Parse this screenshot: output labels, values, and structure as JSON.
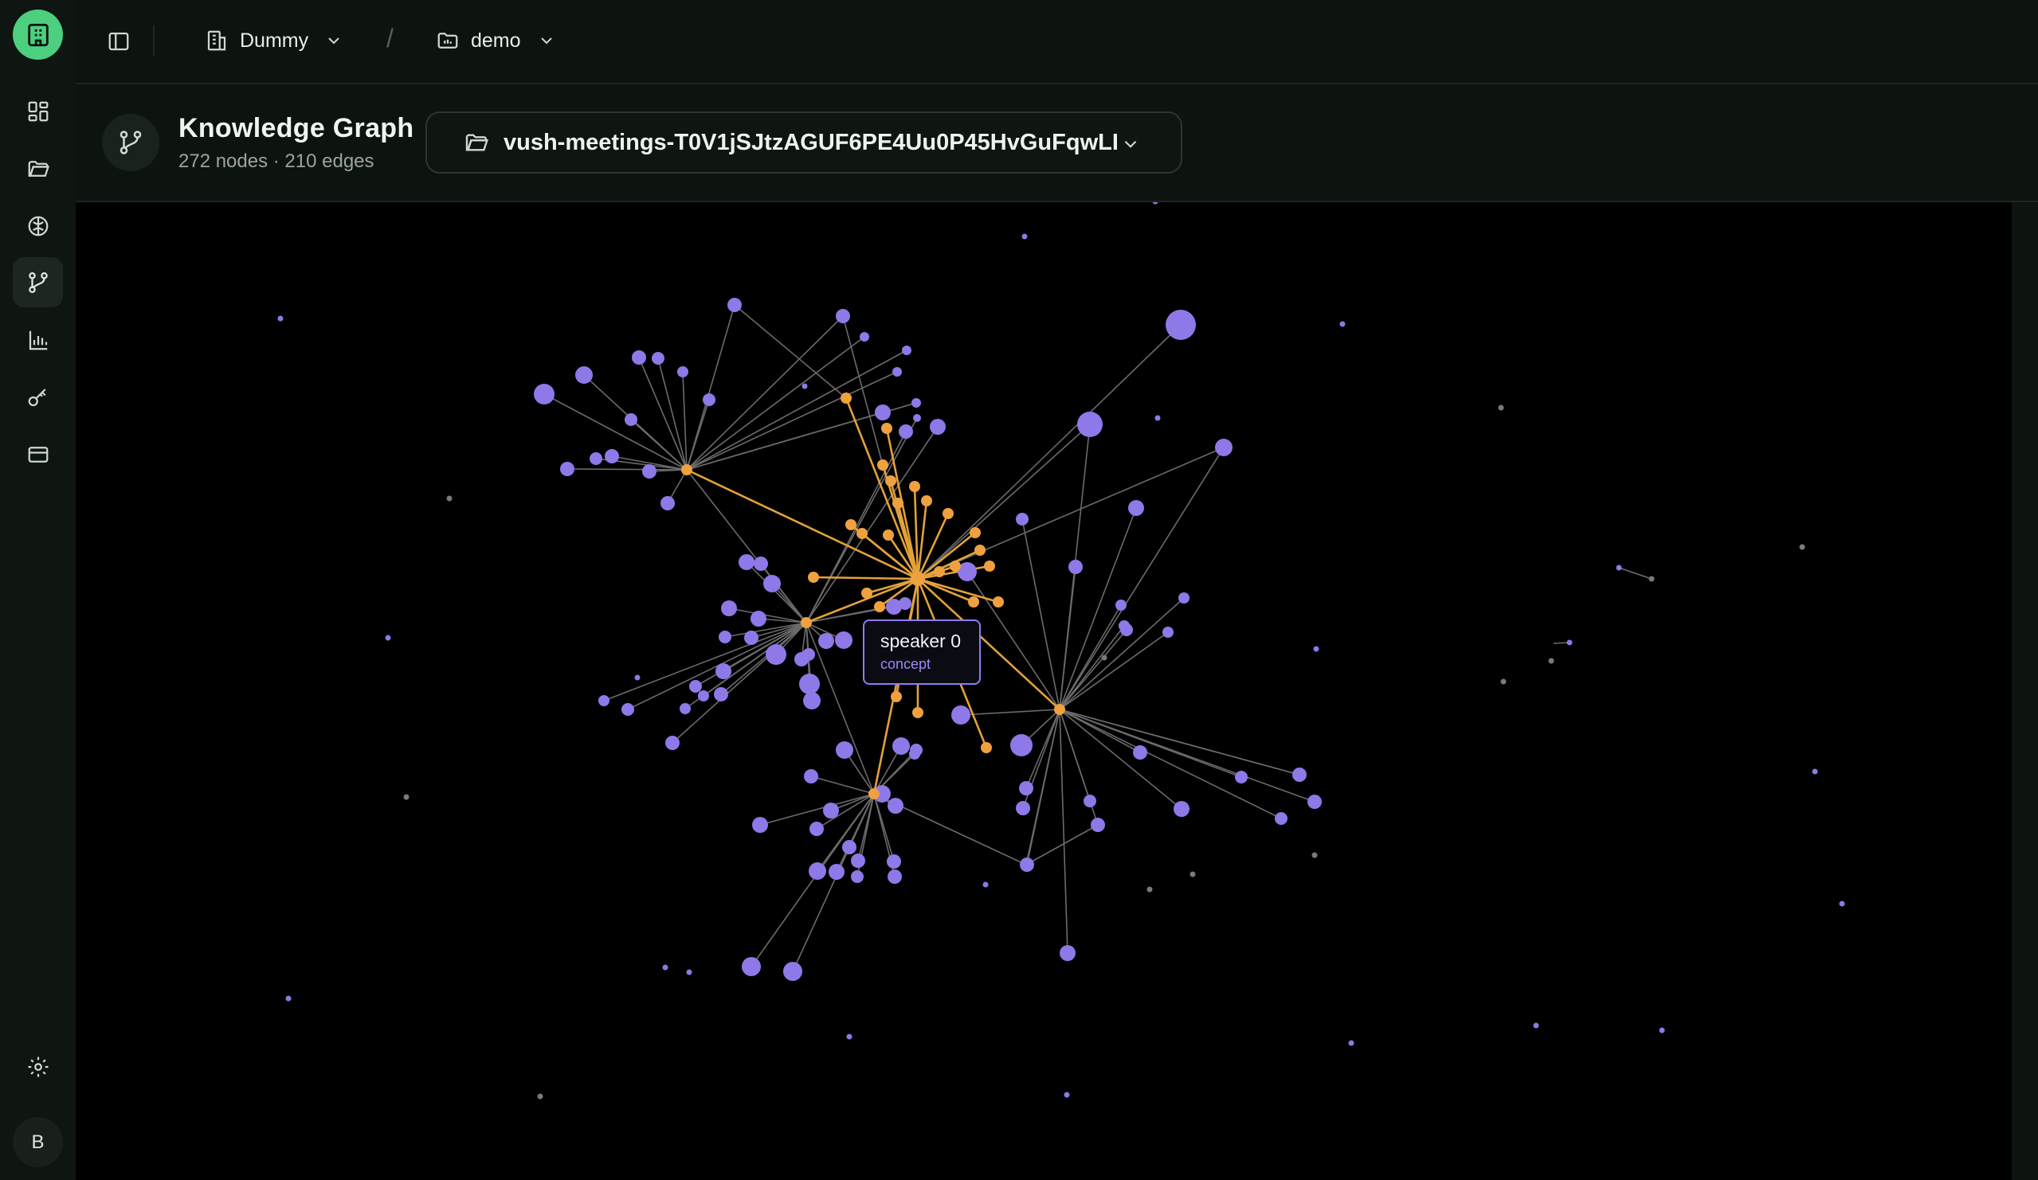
{
  "app": {
    "workspace": "Dummy",
    "project": "demo",
    "avatar_initial": "B"
  },
  "nav": {
    "items": [
      {
        "name": "dashboard-icon"
      },
      {
        "name": "folder-icon"
      },
      {
        "name": "brain-icon"
      },
      {
        "name": "graph-branch-icon",
        "active": true
      },
      {
        "name": "bar-chart-icon"
      },
      {
        "name": "key-icon"
      },
      {
        "name": "credit-card-icon"
      }
    ],
    "settings_icon": "gear-icon"
  },
  "header": {
    "title": "Knowledge Graph",
    "stats": "272 nodes · 210 edges",
    "dataset": "vush-meetings-T0V1jSJtzAGUF6PE4Uu0P45HvGuFqwLI"
  },
  "tooltip": {
    "name": "speaker 0",
    "type": "concept"
  },
  "colors": {
    "accent_green": "#4ccf7e",
    "node_default": "#8f78e8",
    "node_highlight": "#f0a13f",
    "edge_default": "#6b6b6b",
    "edge_highlight": "#e3a23a",
    "background": "#000000"
  }
}
